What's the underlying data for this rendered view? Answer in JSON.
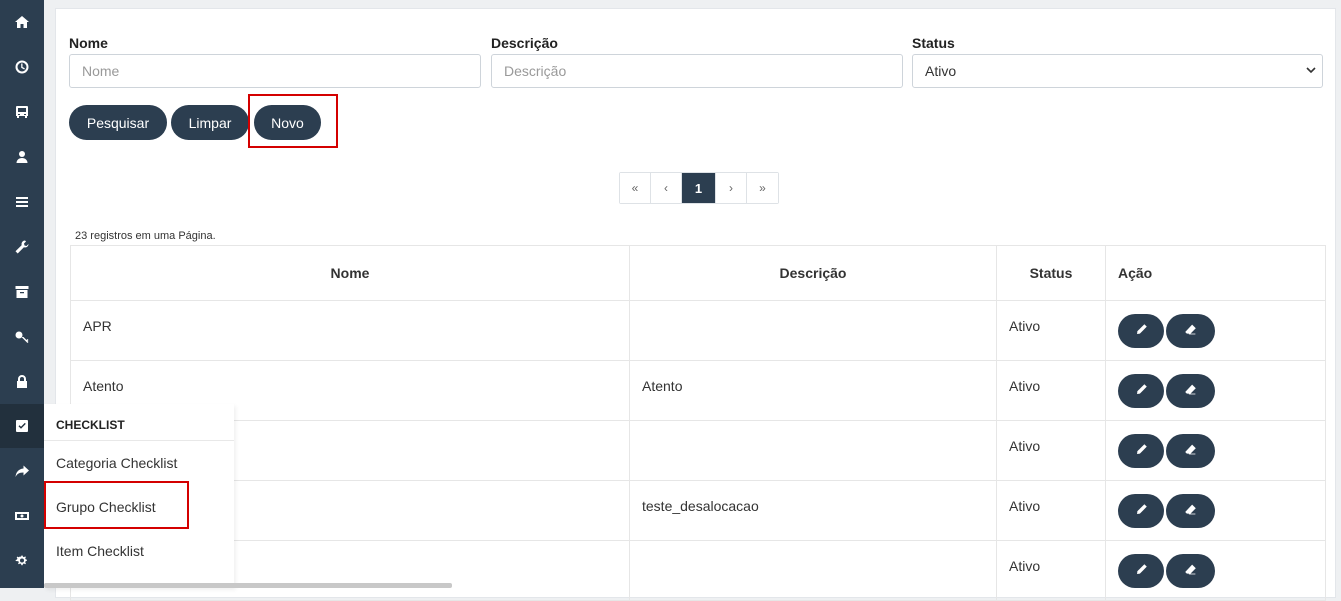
{
  "sidebar": {
    "icons": [
      "home-icon",
      "clock-icon",
      "bus-icon",
      "user-icon",
      "list-icon",
      "wrench-icon",
      "archive-icon",
      "key-icon",
      "lock-icon",
      "check-square-icon",
      "share-icon",
      "money-icon",
      "cogs-icon"
    ],
    "active": "check-square-icon"
  },
  "filters": {
    "nome_label": "Nome",
    "nome_placeholder": "Nome",
    "descricao_label": "Descrição",
    "descricao_placeholder": "Descrição",
    "status_label": "Status",
    "status_value": "Ativo"
  },
  "buttons": {
    "pesquisar": "Pesquisar",
    "limpar": "Limpar",
    "novo": "Novo"
  },
  "pagination": {
    "first": "«",
    "prev": "‹",
    "current": "1",
    "next": "›",
    "last": "»"
  },
  "records_text": "23 registros em uma Página.",
  "table": {
    "headers": {
      "nome": "Nome",
      "descricao": "Descrição",
      "status": "Status",
      "acao": "Ação"
    },
    "rows": [
      {
        "nome": "APR",
        "descricao": "",
        "status": "Ativo"
      },
      {
        "nome": "Atento",
        "descricao": "Atento",
        "status": "Ativo"
      },
      {
        "nome": "",
        "descricao": "",
        "status": "Ativo"
      },
      {
        "nome": "",
        "descricao": "teste_desalocacao",
        "status": "Ativo"
      },
      {
        "nome": "",
        "descricao": "",
        "status": "Ativo"
      }
    ],
    "action_icons": [
      "pencil-icon",
      "eraser-icon"
    ]
  },
  "flyout": {
    "header": "CHECKLIST",
    "items": [
      "Categoria Checklist",
      "Grupo Checklist",
      "Item Checklist"
    ]
  },
  "colors": {
    "sidebar": "#2c3e50",
    "button": "#2c3e50",
    "highlight": "#d40000"
  }
}
